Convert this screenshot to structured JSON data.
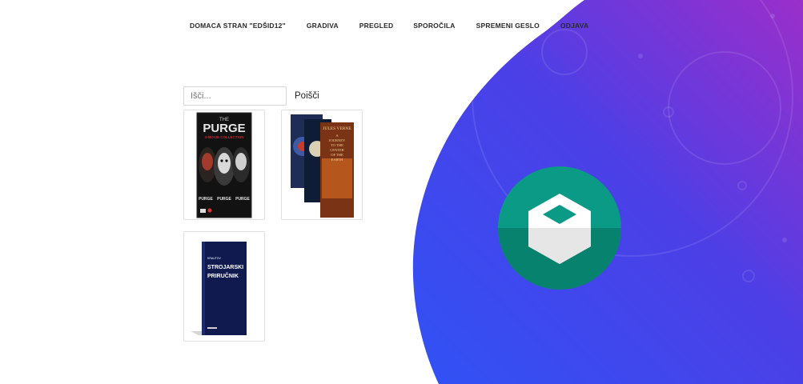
{
  "nav": {
    "items": [
      {
        "label": "DOMACA STRAN \"EDŠID12\""
      },
      {
        "label": "GRADIVA"
      },
      {
        "label": "PREGLED"
      },
      {
        "label": "SPOROČILA"
      },
      {
        "label": "SPREMENI GESLO"
      },
      {
        "label": "ODJAVA"
      }
    ]
  },
  "search": {
    "placeholder": "Išči...",
    "button_label": "Poišči"
  },
  "items": [
    {
      "cover_title": "PURGE",
      "cover_top": "THE",
      "cover_subtitle": "3-MOVIE COLLECTION",
      "spine_labels": [
        "PURGE",
        "PURGE",
        "PURGE"
      ]
    },
    {
      "cover_author": "JULES VERNE",
      "cover_title_lines": [
        "A",
        "JOURNEY",
        "TO THE",
        "CENTER",
        "OF THE",
        "EARTH"
      ]
    },
    {
      "cover_author": "KRAUTOV",
      "cover_title_lines": [
        "STROJARSKI",
        "PRIRUČNIK"
      ]
    }
  ],
  "colors": {
    "blob_start": "#2f56f5",
    "blob_end": "#8c2fcf",
    "logo_circle": "#0a9a86",
    "logo_circle_dark": "#07826f"
  },
  "logo_icon": "cube-icon"
}
